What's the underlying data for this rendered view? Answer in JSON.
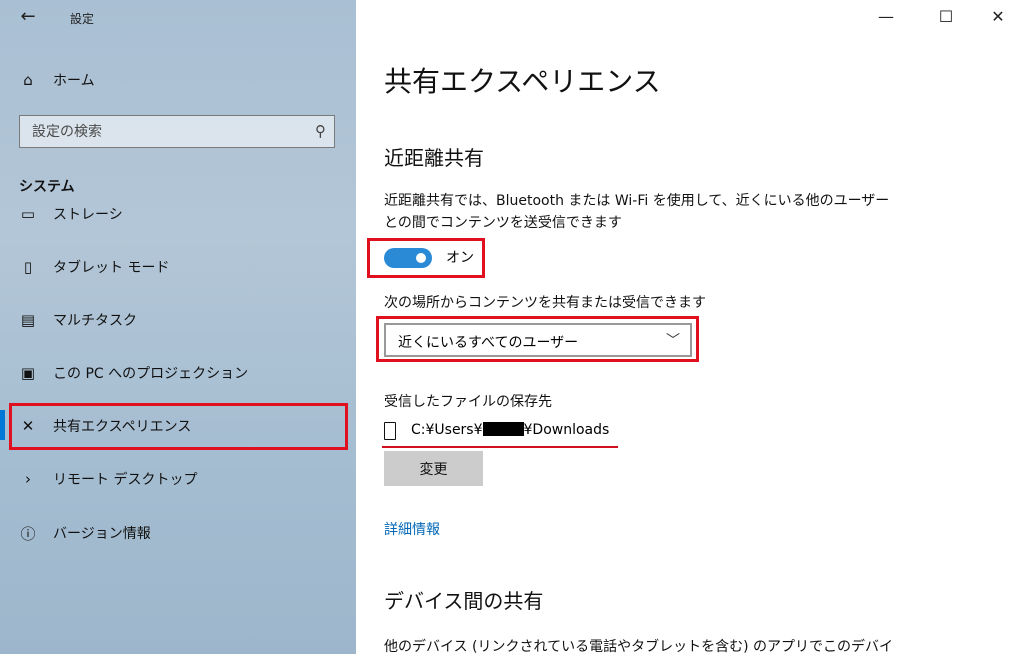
{
  "app": {
    "title": "設定"
  },
  "sidebar": {
    "home_label": "ホーム",
    "search_placeholder": "設定の検索",
    "section_label": "システム",
    "items": [
      {
        "label": "ストレーシ",
        "icon": "storage-icon"
      },
      {
        "label": "タブレット モード",
        "icon": "tablet-icon"
      },
      {
        "label": "マルチタスク",
        "icon": "multitask-icon"
      },
      {
        "label": "この PC へのプロジェクション",
        "icon": "projection-icon"
      },
      {
        "label": "共有エクスペリエンス",
        "icon": "shared-experience-icon"
      },
      {
        "label": "リモート デスクトップ",
        "icon": "remote-desktop-icon"
      },
      {
        "label": "バージョン情報",
        "icon": "info-icon"
      }
    ],
    "active_index": 4
  },
  "window_controls": {
    "minimize": "—",
    "maximize": "☐",
    "close": "✕"
  },
  "main": {
    "title": "共有エクスペリエンス",
    "nearby": {
      "heading": "近距離共有",
      "description": "近距離共有では、Bluetooth または Wi-Fi を使用して、近くにいる他のユーザーとの間でコンテンツを送受信できます",
      "toggle_state": "オン",
      "toggle_on": true,
      "share_label": "次の場所からコンテンツを共有または受信できます",
      "share_selected": "近くにいるすべてのユーザー",
      "save_label": "受信したファイルの保存先",
      "save_path_prefix": "C:¥Users¥",
      "save_path_suffix": "¥Downloads",
      "change_button": "変更",
      "details_link": "詳細情報"
    },
    "cross_device": {
      "heading": "デバイス間の共有",
      "description": "他のデバイス (リンクされている電話やタブレットを含む) のアプリでこのデバイ"
    }
  },
  "colors": {
    "accent": "#0078d7",
    "toggle": "#2b8ad6",
    "highlight": "#e0101e",
    "link": "#0067b8"
  }
}
